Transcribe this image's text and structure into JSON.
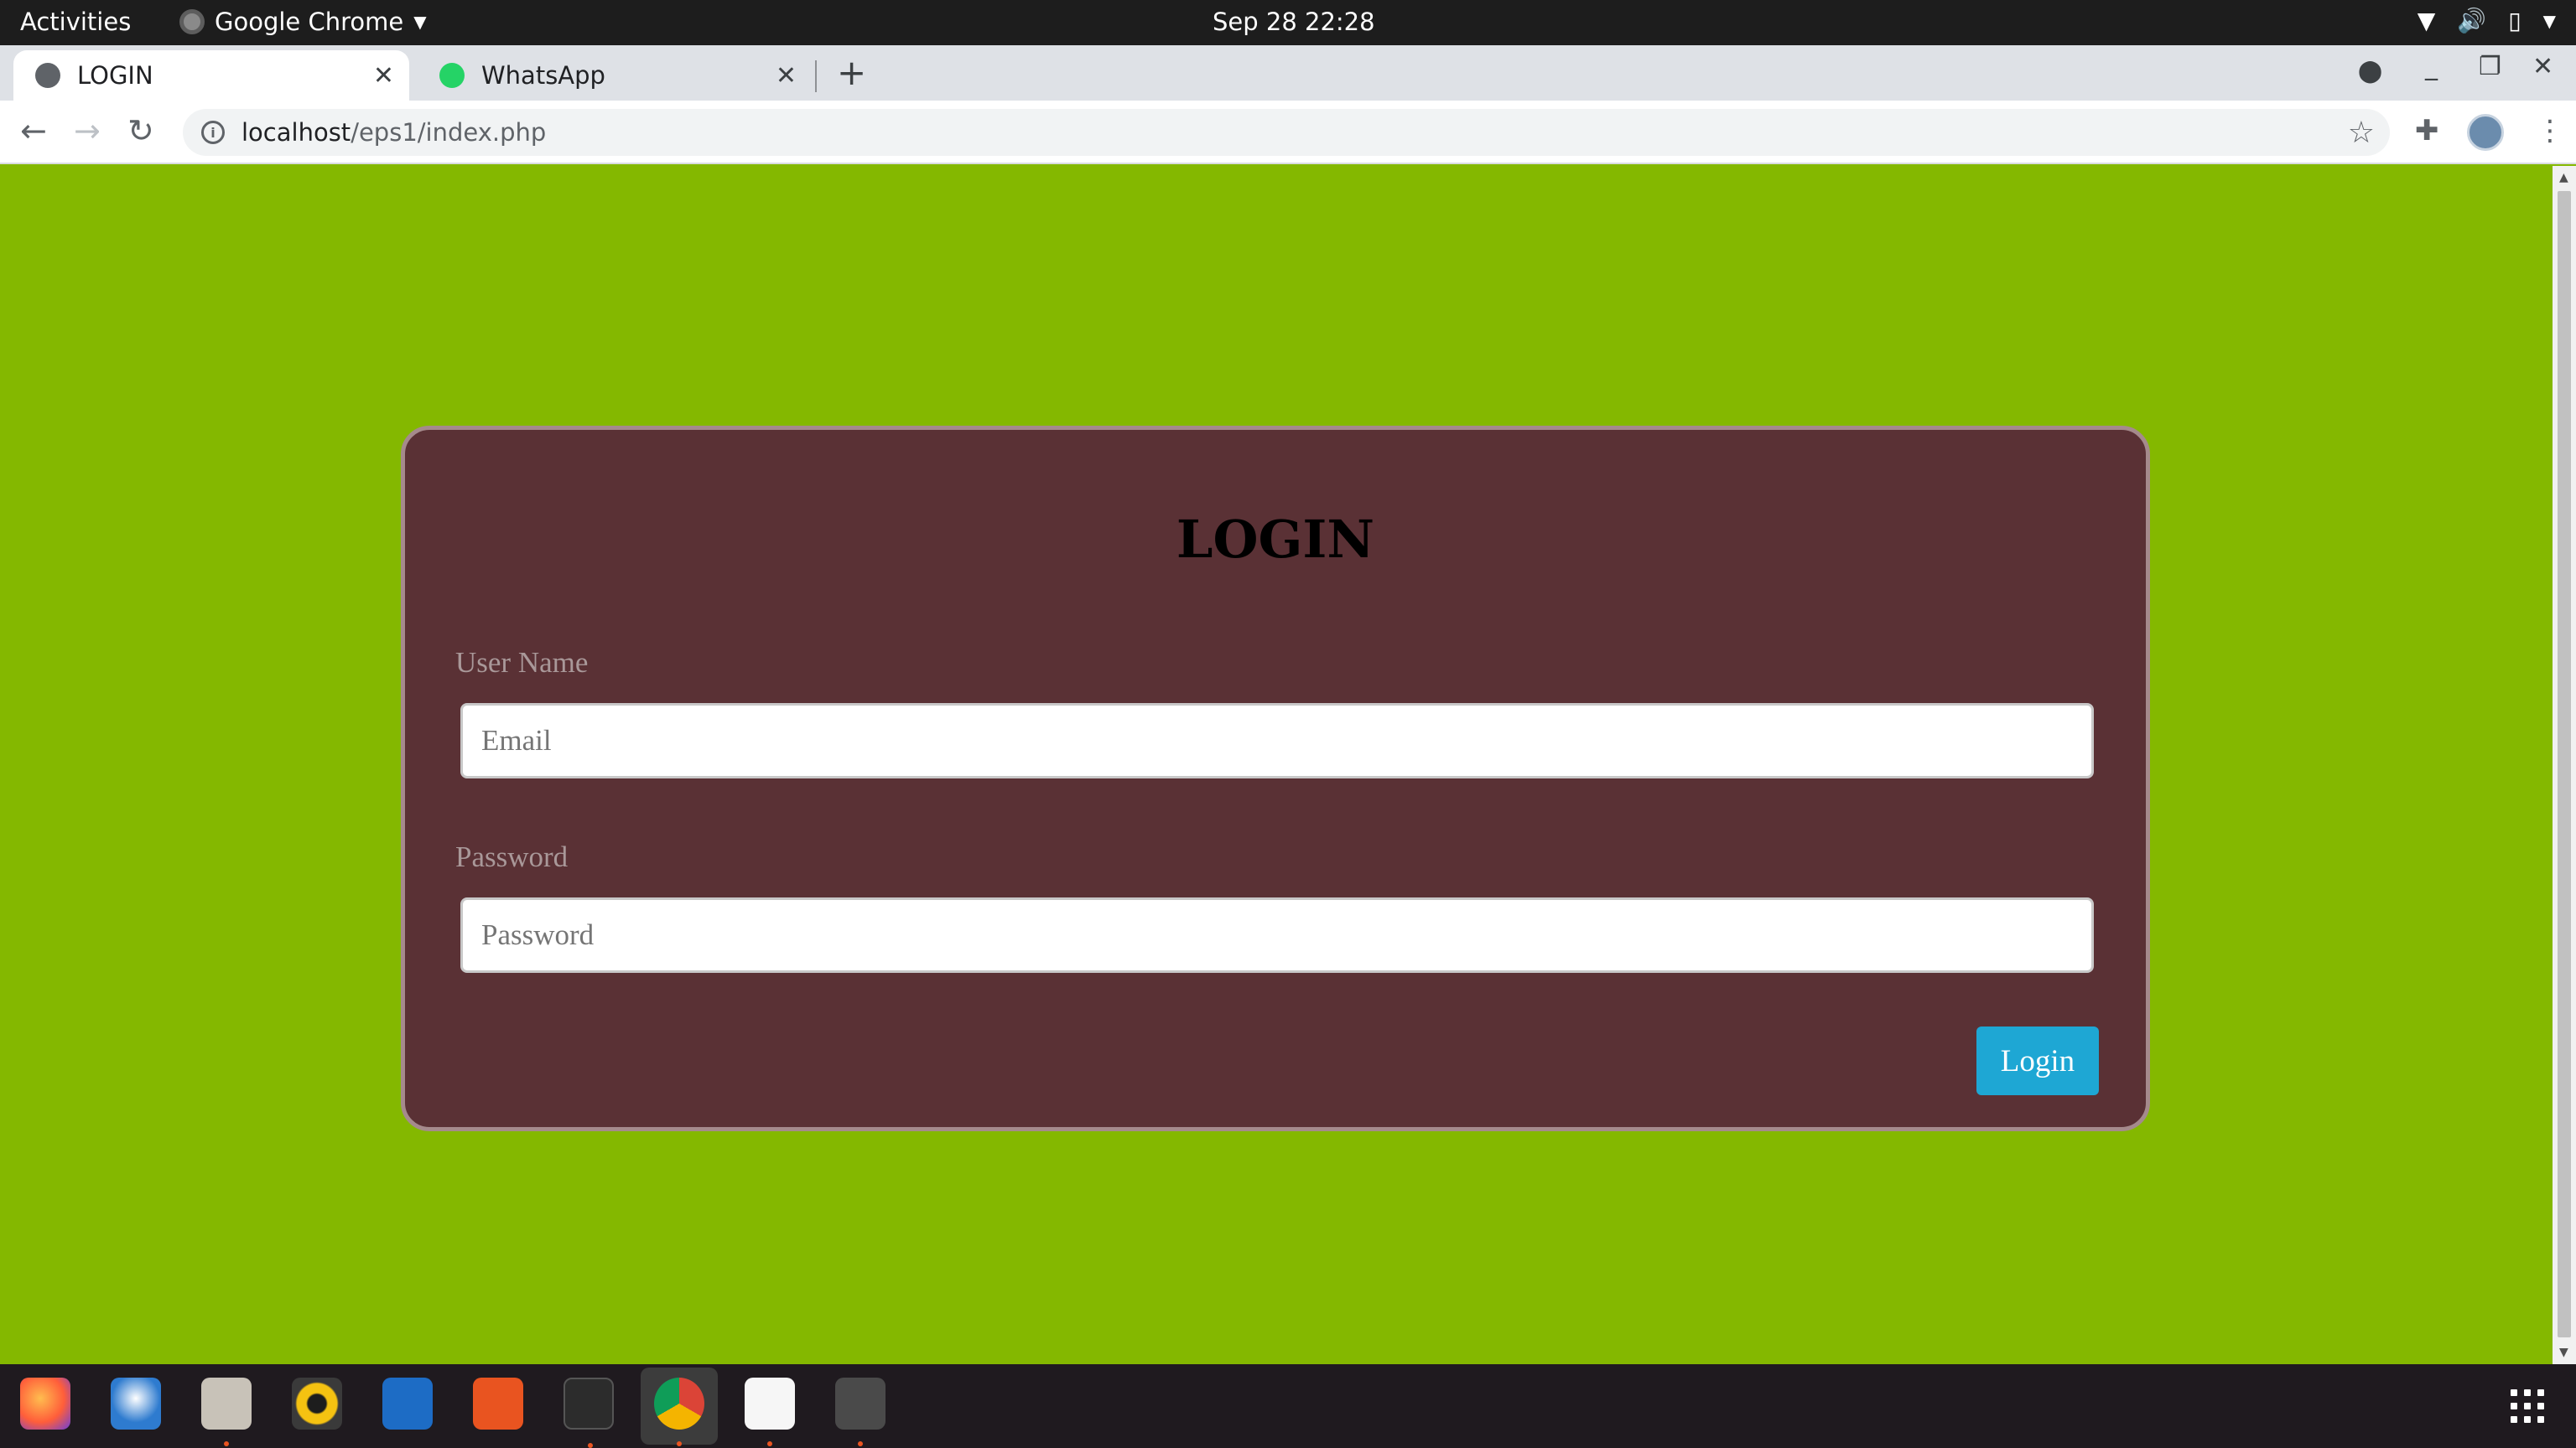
{
  "topbar": {
    "activities": "Activities",
    "app_name": "Google Chrome",
    "clock": "Sep 28  22:28"
  },
  "tabs": [
    {
      "title": "LOGIN",
      "active": true
    },
    {
      "title": "WhatsApp",
      "active": false
    }
  ],
  "address_bar": {
    "host": "localhost",
    "path": "/eps1/index.php"
  },
  "page": {
    "heading": "LOGIN",
    "username_label": "User Name",
    "username_placeholder": "Email",
    "password_label": "Password",
    "password_placeholder": "Password",
    "login_button": "Login"
  },
  "colors": {
    "page_background": "#84b800",
    "card_background": "#5a3135",
    "button": "#1ea7d4"
  },
  "dock_icons": [
    "firefox-icon",
    "thunderbird-icon",
    "files-icon",
    "rhythmbox-icon",
    "writer-icon",
    "software-icon",
    "terminal-icon",
    "chrome-icon",
    "text-editor-icon",
    "sublime-icon"
  ]
}
